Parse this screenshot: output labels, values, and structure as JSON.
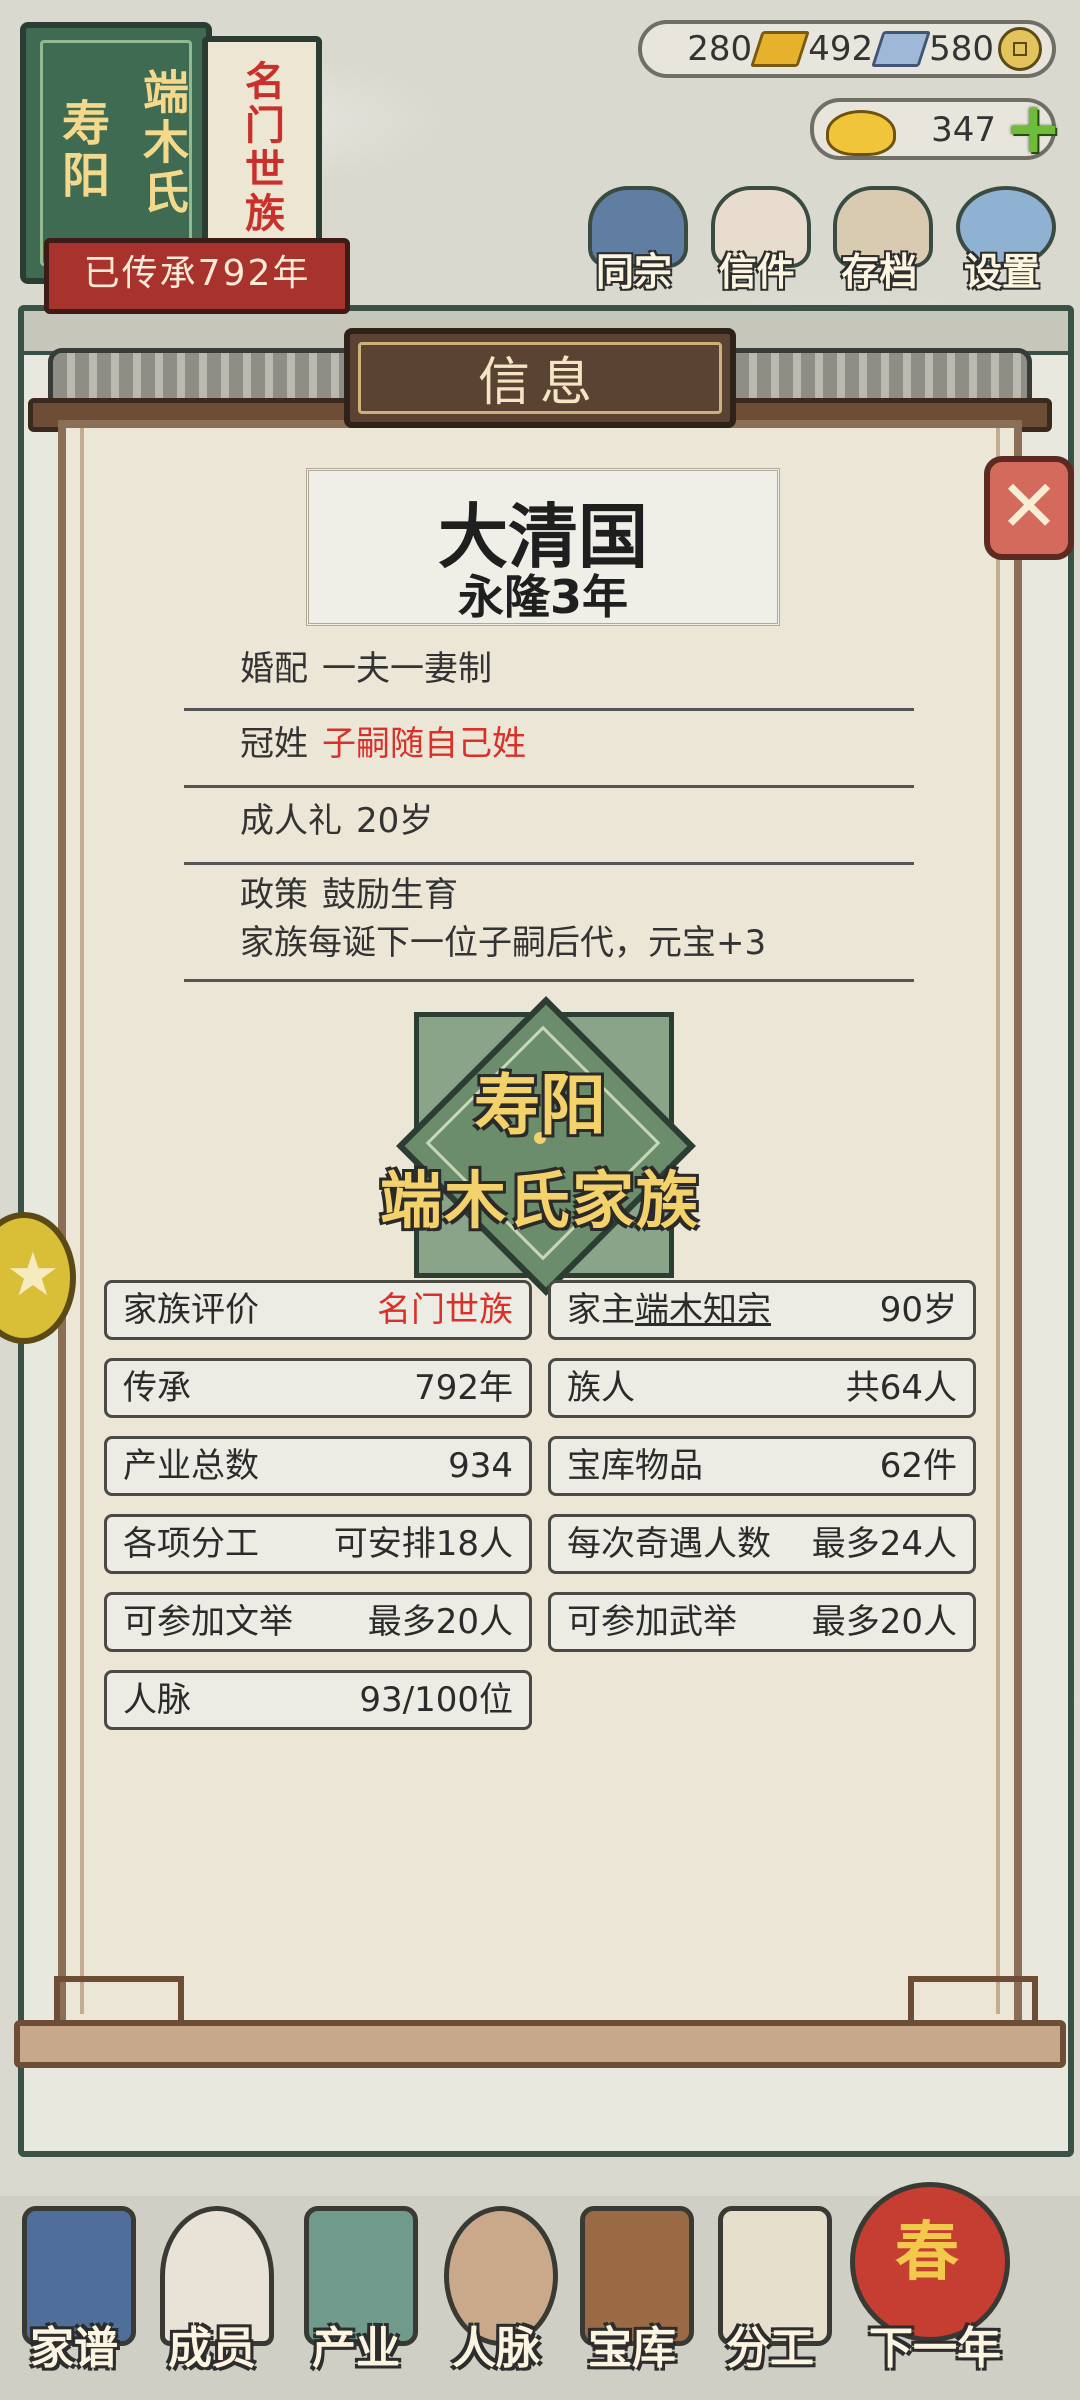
{
  "badge": {
    "book_left": [
      "寿阳",
      "端木氏"
    ],
    "book_right": "名门世族",
    "ribbon": "已传承792年"
  },
  "resources": {
    "gold": "280",
    "silver": "492",
    "coins": "580",
    "yuanbao": "347"
  },
  "top_nav": [
    {
      "label": "同宗",
      "icon": "clan-book-icon"
    },
    {
      "label": "信件",
      "icon": "letter-icon"
    },
    {
      "label": "存档",
      "icon": "save-scroll-icon"
    },
    {
      "label": "设置",
      "icon": "gear-icon"
    }
  ],
  "panel": {
    "title": "信息",
    "country": "大清国",
    "era": "永隆3年",
    "rules": [
      {
        "key": "婚配",
        "value": "一夫一妻制",
        "highlight": false
      },
      {
        "key": "冠姓",
        "value": "子嗣随自己姓",
        "highlight": true
      },
      {
        "key": "成人礼",
        "value": "20岁",
        "highlight": false
      },
      {
        "key": "政策",
        "value": "鼓励生育",
        "detail": "家族每诞下一位子嗣后代，元宝+3",
        "highlight": false
      }
    ],
    "emblem": {
      "line1": "寿阳",
      "line2": "端木氏家族"
    },
    "stats": [
      {
        "label": "家族评价",
        "value": "名门世族"
      },
      {
        "label": "家主",
        "name": "端木知宗",
        "value": "90岁"
      },
      {
        "label": "传承",
        "value": "792年"
      },
      {
        "label": "族人",
        "value": "共64人"
      },
      {
        "label": "产业总数",
        "value": "934"
      },
      {
        "label": "宝库物品",
        "value": "62件"
      },
      {
        "label": "各项分工",
        "value": "可安排18人"
      },
      {
        "label": "每次奇遇人数",
        "value": "最多24人"
      },
      {
        "label": "可参加文举",
        "value": "最多20人"
      },
      {
        "label": "可参加武举",
        "value": "最多20人"
      },
      {
        "label": "人脉",
        "value": "93/100位"
      }
    ]
  },
  "bottom_nav": [
    {
      "label": "家谱",
      "icon": "genealogy-book-icon",
      "color": "#4f6f9a"
    },
    {
      "label": "成员",
      "icon": "member-portrait-icon",
      "color": "#e8e3d6"
    },
    {
      "label": "产业",
      "icon": "building-icon",
      "color": "#6f9a8c"
    },
    {
      "label": "人脉",
      "icon": "network-icon",
      "color": "#c9a98a"
    },
    {
      "label": "宝库",
      "icon": "treasure-chest-icon",
      "color": "#9a6a44"
    },
    {
      "label": "分工",
      "icon": "scroll-icon",
      "color": "#e6dfcc"
    },
    {
      "label": "下一年",
      "icon": "lantern-icon",
      "char": "春"
    }
  ]
}
